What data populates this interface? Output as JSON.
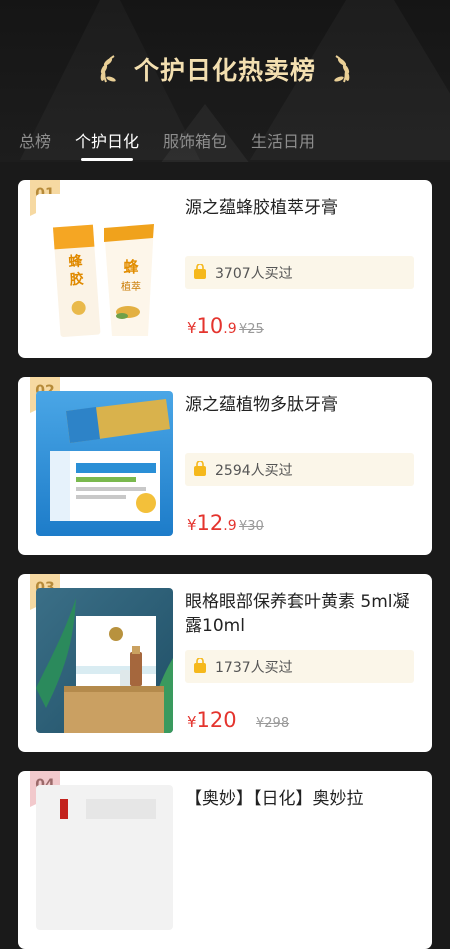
{
  "page": {
    "title": "个护日化热卖榜",
    "tabs": [
      {
        "label": "总榜"
      },
      {
        "label": "个护日化",
        "active": true
      },
      {
        "label": "服饰箱包"
      },
      {
        "label": "生活日用"
      }
    ]
  },
  "colors": {
    "background": "#1a1a1a",
    "title_gold": "#f3dfb0",
    "rank_badge": "#f6d9a2",
    "price_red": "#e4342e",
    "buyers_bg": "#fbf6e9"
  },
  "products": [
    {
      "rank": "01",
      "name": "源之蕴蜂胶植萃牙膏",
      "buyers": "3707人买过",
      "price_currency": "¥",
      "price_int": "10",
      "price_dec": ".9",
      "old_price": "¥25",
      "image": "toothpaste-tube-honey"
    },
    {
      "rank": "02",
      "name": "源之蕴植物多肽牙膏",
      "buyers": "2594人买过",
      "price_currency": "¥",
      "price_int": "12",
      "price_dec": ".9",
      "old_price": "¥30",
      "image": "toothpaste-box-blue"
    },
    {
      "rank": "03",
      "name": "眼格眼部保养套叶黄素 5ml凝露10ml",
      "buyers": "1737人买过",
      "price_currency": "¥",
      "price_int": "120",
      "price_dec": "",
      "old_price": "¥298",
      "image": "eye-care-set"
    },
    {
      "rank": "04",
      "name": "【奥妙】【日化】奥妙拉",
      "buyers": "",
      "price_currency": "",
      "price_int": "",
      "price_dec": "",
      "old_price": "",
      "image": "product-image"
    }
  ]
}
